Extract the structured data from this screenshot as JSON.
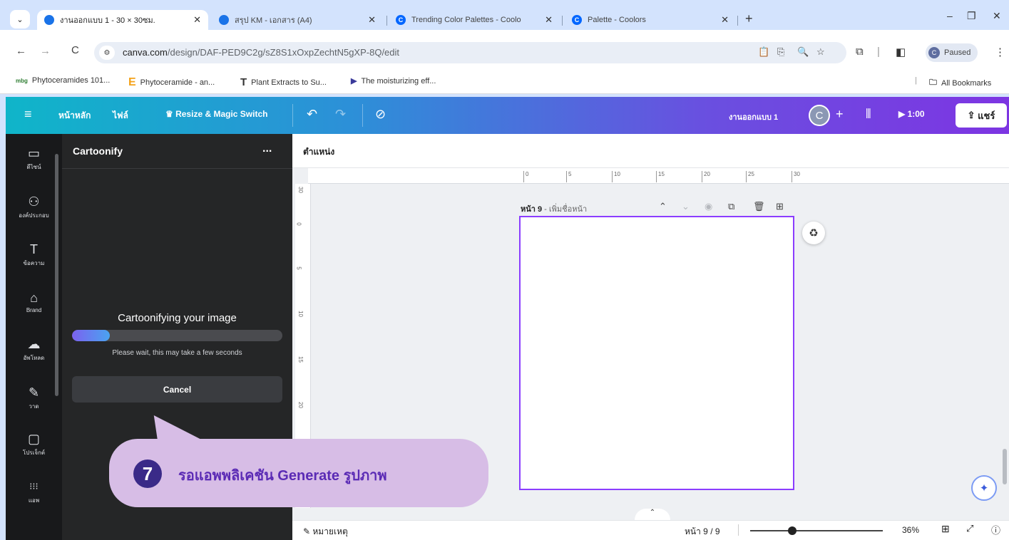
{
  "browser": {
    "tabs": [
      {
        "title": "งานออกแบบ 1 - 30 × 30ซม.",
        "active": true
      },
      {
        "title": "สรุป KM - เอกสาร (A4)",
        "active": false
      },
      {
        "title": "Trending Color Palettes - Coolo",
        "active": false
      },
      {
        "title": "Palette - Coolors",
        "active": false
      }
    ],
    "new_tab": "+",
    "url_host": "canva.com",
    "url_path": "/design/DAF-PED9C2g/sZ8S1xOxpZechtN5gXP-8Q/edit",
    "profile_status": "Paused",
    "bookmarks": [
      {
        "icon": "mbg",
        "label": "Phytoceramides 101..."
      },
      {
        "icon": "E",
        "label": "Phytoceramide - an..."
      },
      {
        "icon": "T",
        "label": "Plant Extracts to Su..."
      },
      {
        "icon": "▶",
        "label": "The moisturizing eff..."
      }
    ],
    "all_bookmarks": "All Bookmarks"
  },
  "canva_header": {
    "home": "หน้าหลัก",
    "file": "ไฟล์",
    "resize": "Resize & Magic Switch",
    "design_name": "งานออกแบบ 1",
    "avatar_letter": "C",
    "play_time": "1:00",
    "share": "แชร์"
  },
  "rail": [
    {
      "icon": "▭",
      "label": "ดีไซน์"
    },
    {
      "icon": "⚇",
      "label": "องค์ประกอบ"
    },
    {
      "icon": "T",
      "label": "ข้อความ"
    },
    {
      "icon": "⌂",
      "label": "Brand"
    },
    {
      "icon": "☁",
      "label": "อัพโหลด"
    },
    {
      "icon": "✎",
      "label": "วาด"
    },
    {
      "icon": "▢",
      "label": "โปรเจ็กต์"
    },
    {
      "icon": "⁝⁝⁝",
      "label": "แอพ"
    }
  ],
  "panel": {
    "title": "Cartoonify",
    "more": "...",
    "loading_title": "Cartoonifying your image",
    "progress": 0.18,
    "loading_sub": "Please wait, this may take a few seconds",
    "cancel": "Cancel"
  },
  "canvas": {
    "position_label": "ตำแหน่ง",
    "ruler_ticks": [
      "0",
      "5",
      "10",
      "15",
      "20",
      "25",
      "30"
    ],
    "ruler_left_ticks": [
      "30",
      "0",
      "5",
      "10",
      "15",
      "20",
      "25"
    ],
    "page_label_bold": "หน้า 9",
    "page_label_rest": " - เพิ่มชื่อหน้า"
  },
  "bottom_bar": {
    "notes": "หมายเหตุ",
    "page_count": "หน้า 9 / 9",
    "zoom": "36%"
  },
  "callout": {
    "step": "7",
    "text": "รอแอพพลิเคชัน Generate รูปภาพ"
  },
  "colors": {
    "accent": "#8b3dff",
    "callout_bg": "#d7bde6",
    "callout_text": "#5b2bb5"
  }
}
